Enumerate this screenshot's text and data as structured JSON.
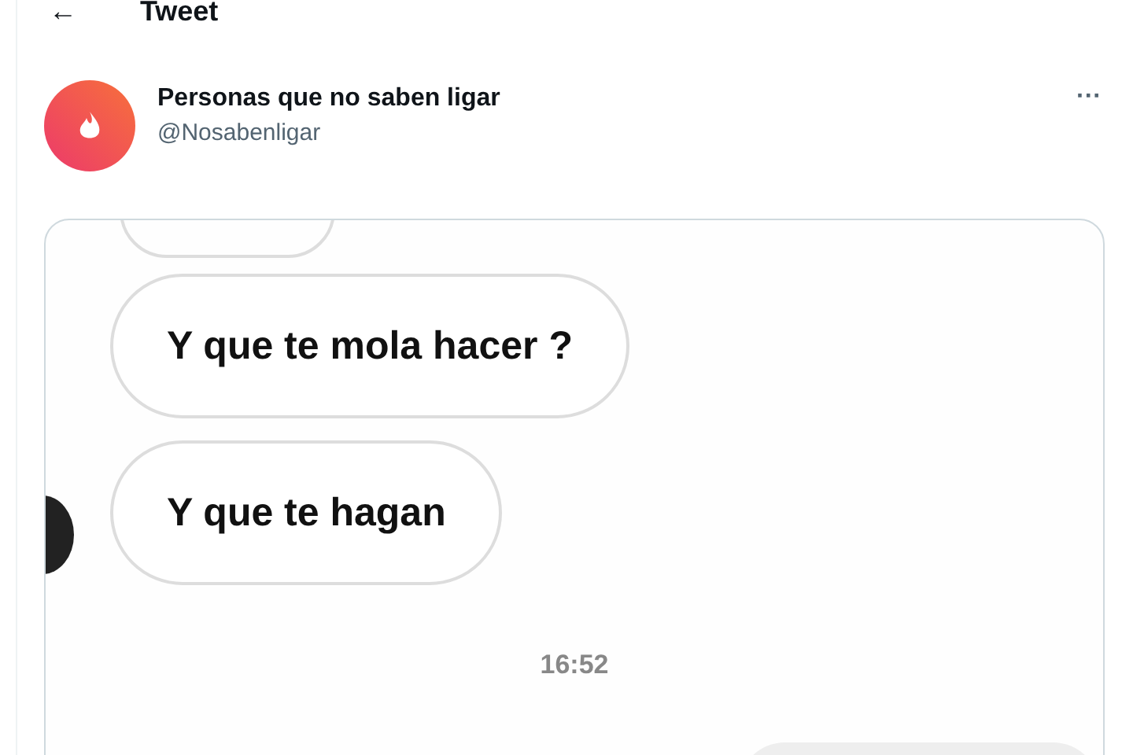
{
  "header": {
    "back_icon": "←",
    "title": "Tweet"
  },
  "tweet": {
    "author": {
      "name": "Personas que no saben ligar",
      "handle": "@Nosabenligar"
    },
    "more": "···",
    "chat_image": {
      "messages": [
        {
          "kind": "received",
          "text": "Y que te mola hacer ?"
        },
        {
          "kind": "received",
          "text": "Y que te hagan"
        }
      ],
      "timestamp": "16:52"
    }
  }
}
